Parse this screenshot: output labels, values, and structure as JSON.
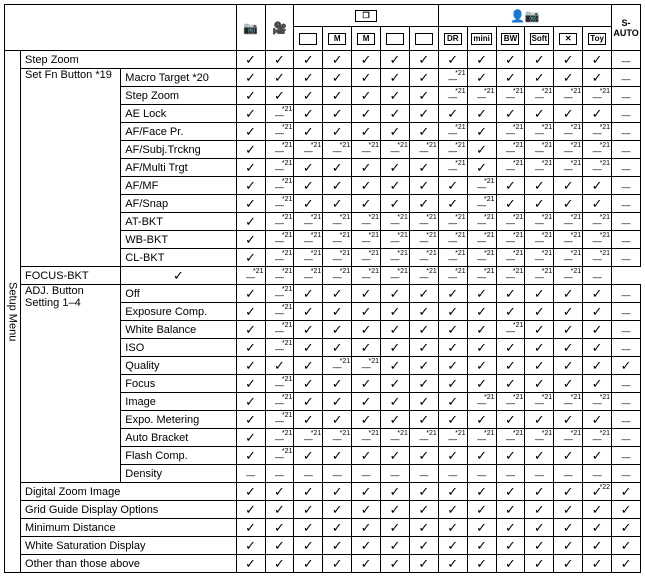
{
  "side_label": "Setup Menu",
  "header": {
    "s_auto": "S-\nAUTO",
    "icons": [
      {
        "type": "plain",
        "glyph": "📷",
        "name": "camera-icon"
      },
      {
        "type": "plain",
        "glyph": "🎥",
        "name": "movie-icon"
      },
      {
        "type": "box",
        "glyph": "",
        "name": "cont1-icon"
      },
      {
        "type": "box",
        "glyph": "M",
        "name": "cont2-icon"
      },
      {
        "type": "box",
        "glyph": "M",
        "name": "cont3-icon"
      },
      {
        "type": "box",
        "glyph": "",
        "name": "cont4-icon"
      },
      {
        "type": "box",
        "glyph": "",
        "name": "cont5-icon"
      },
      {
        "type": "box",
        "glyph": "DR",
        "name": "scene-dr-icon"
      },
      {
        "type": "box",
        "glyph": "mini",
        "name": "scene-mini-icon"
      },
      {
        "type": "box",
        "glyph": "BW",
        "name": "scene-bw-icon"
      },
      {
        "type": "box",
        "glyph": "Soft",
        "name": "scene-soft-icon"
      },
      {
        "type": "box",
        "glyph": "✕",
        "name": "scene-cross-icon"
      },
      {
        "type": "box",
        "glyph": "Toy",
        "name": "scene-toy-icon"
      }
    ]
  },
  "groups": [
    {
      "a": "Step Zoom",
      "span_a": 2,
      "b": null,
      "vals": [
        "c",
        "c",
        "c",
        "c",
        "c",
        "c",
        "c",
        "c",
        "c",
        "c",
        "c",
        "c",
        "c",
        "d"
      ]
    },
    {
      "a": "Set Fn Button *19",
      "a_rows": 11,
      "b": "Macro Target *20",
      "vals": [
        "c",
        "c",
        "c",
        "c",
        "c",
        "c",
        "c",
        "n",
        "c",
        "c",
        "c",
        "c",
        "c",
        "d"
      ]
    },
    {
      "b": "Step Zoom",
      "vals": [
        "c",
        "c",
        "c",
        "c",
        "c",
        "c",
        "c",
        "n",
        "n",
        "n",
        "n",
        "n",
        "n",
        "d"
      ]
    },
    {
      "b": "AE Lock",
      "vals": [
        "c",
        "n",
        "c",
        "c",
        "c",
        "c",
        "c",
        "c",
        "c",
        "c",
        "c",
        "c",
        "c",
        "d"
      ]
    },
    {
      "b": "AF/Face Pr.",
      "vals": [
        "c",
        "n",
        "c",
        "c",
        "c",
        "c",
        "c",
        "n",
        "c",
        "n",
        "n",
        "n",
        "n",
        "d"
      ]
    },
    {
      "b": "AF/Subj.Trckng",
      "vals": [
        "c",
        "n",
        "n",
        "n",
        "n",
        "n",
        "n",
        "n",
        "c",
        "n",
        "n",
        "n",
        "n",
        "d"
      ]
    },
    {
      "b": "AF/Multi Trgt",
      "vals": [
        "c",
        "n",
        "c",
        "c",
        "c",
        "c",
        "c",
        "n",
        "c",
        "n",
        "n",
        "n",
        "n",
        "d"
      ]
    },
    {
      "b": "AF/MF",
      "vals": [
        "c",
        "n",
        "c",
        "c",
        "c",
        "c",
        "c",
        "c",
        "n",
        "c",
        "c",
        "c",
        "c",
        "d"
      ]
    },
    {
      "b": "AF/Snap",
      "vals": [
        "c",
        "n",
        "c",
        "c",
        "c",
        "c",
        "c",
        "c",
        "n",
        "c",
        "c",
        "c",
        "c",
        "d"
      ]
    },
    {
      "b": "AT-BKT",
      "vals": [
        "c",
        "n",
        "n",
        "n",
        "n",
        "n",
        "n",
        "n",
        "n",
        "n",
        "n",
        "n",
        "n",
        "d"
      ]
    },
    {
      "b": "WB-BKT",
      "vals": [
        "c",
        "n",
        "n",
        "n",
        "n",
        "n",
        "n",
        "n",
        "n",
        "n",
        "n",
        "n",
        "n",
        "d"
      ]
    },
    {
      "b": "CL-BKT",
      "vals": [
        "c",
        "n",
        "n",
        "n",
        "n",
        "n",
        "n",
        "n",
        "n",
        "n",
        "n",
        "n",
        "n",
        "d"
      ]
    },
    {
      "b": "FOCUS-BKT",
      "vals": [
        "c",
        "n",
        "n",
        "n",
        "n",
        "n",
        "n",
        "n",
        "n",
        "n",
        "n",
        "n",
        "n",
        "d"
      ]
    },
    {
      "a": "ADJ. Button Setting 1–4",
      "a_rows": 11,
      "b": "Off",
      "vals": [
        "c",
        "n",
        "c",
        "c",
        "c",
        "c",
        "c",
        "c",
        "c",
        "c",
        "c",
        "c",
        "c",
        "d"
      ]
    },
    {
      "b": "Exposure Comp.",
      "vals": [
        "c",
        "n",
        "c",
        "c",
        "c",
        "c",
        "c",
        "c",
        "c",
        "c",
        "c",
        "c",
        "c",
        "d"
      ]
    },
    {
      "b": "White Balance",
      "vals": [
        "c",
        "n",
        "c",
        "c",
        "c",
        "c",
        "c",
        "c",
        "c",
        "n",
        "c",
        "c",
        "c",
        "d"
      ]
    },
    {
      "b": "ISO",
      "vals": [
        "c",
        "n",
        "c",
        "c",
        "c",
        "c",
        "c",
        "c",
        "c",
        "c",
        "c",
        "c",
        "c",
        "d"
      ]
    },
    {
      "b": "Quality",
      "vals": [
        "c",
        "c",
        "c",
        "n",
        "n",
        "c",
        "c",
        "c",
        "c",
        "c",
        "c",
        "c",
        "c",
        "c"
      ]
    },
    {
      "b": "Focus",
      "vals": [
        "c",
        "n",
        "c",
        "c",
        "c",
        "c",
        "c",
        "c",
        "c",
        "c",
        "c",
        "c",
        "c",
        "d"
      ]
    },
    {
      "b": "Image",
      "vals": [
        "c",
        "n",
        "c",
        "c",
        "c",
        "c",
        "c",
        "c",
        "n",
        "n",
        "n",
        "n",
        "n",
        "d"
      ]
    },
    {
      "b": "Expo. Metering",
      "vals": [
        "c",
        "n",
        "c",
        "c",
        "c",
        "c",
        "c",
        "c",
        "c",
        "c",
        "c",
        "c",
        "c",
        "d"
      ]
    },
    {
      "b": "Auto Bracket",
      "vals": [
        "c",
        "n",
        "n",
        "n",
        "n",
        "n",
        "n",
        "n",
        "n",
        "n",
        "n",
        "n",
        "n",
        "d"
      ]
    },
    {
      "b": "Flash Comp.",
      "vals": [
        "c",
        "n",
        "c",
        "c",
        "c",
        "c",
        "c",
        "c",
        "c",
        "c",
        "c",
        "c",
        "c",
        "d"
      ]
    },
    {
      "b": "Density",
      "vals": [
        "d",
        "d",
        "d",
        "d",
        "d",
        "d",
        "d",
        "d",
        "d",
        "d",
        "d",
        "d",
        "d",
        "d"
      ]
    },
    {
      "a": "Digital Zoom Image",
      "span_a": 2,
      "vals": [
        "c",
        "c",
        "c",
        "c",
        "c",
        "c",
        "c",
        "c",
        "c",
        "c",
        "c",
        "c",
        "n22",
        "c"
      ]
    },
    {
      "a": "Grid Guide Display Options",
      "span_a": 2,
      "vals": [
        "c",
        "c",
        "c",
        "c",
        "c",
        "c",
        "c",
        "c",
        "c",
        "c",
        "c",
        "c",
        "c",
        "c"
      ]
    },
    {
      "a": "Minimum Distance",
      "span_a": 2,
      "vals": [
        "c",
        "c",
        "c",
        "c",
        "c",
        "c",
        "c",
        "c",
        "c",
        "c",
        "c",
        "c",
        "c",
        "c"
      ]
    },
    {
      "a": "White Saturation Display",
      "span_a": 2,
      "vals": [
        "c",
        "c",
        "c",
        "c",
        "c",
        "c",
        "c",
        "c",
        "c",
        "c",
        "c",
        "c",
        "c",
        "c"
      ]
    },
    {
      "a": "Other than those above",
      "span_a": 2,
      "vals": [
        "c",
        "c",
        "c",
        "c",
        "c",
        "c",
        "c",
        "c",
        "c",
        "c",
        "c",
        "c",
        "c",
        "c"
      ]
    }
  ]
}
